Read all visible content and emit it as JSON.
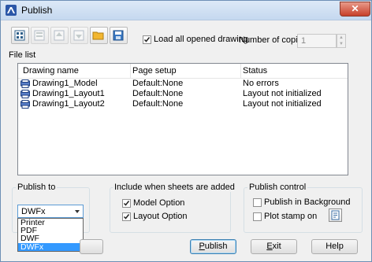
{
  "window": {
    "title": "Publish",
    "close_label": "✕"
  },
  "toolbar": {
    "buttons": [
      {
        "name": "add-sheets-icon",
        "enabled": true
      },
      {
        "name": "remove-sheets-icon",
        "enabled": false
      },
      {
        "name": "move-up-icon",
        "enabled": false
      },
      {
        "name": "move-down-icon",
        "enabled": false
      },
      {
        "name": "open-folder-icon",
        "enabled": true
      },
      {
        "name": "save-list-icon",
        "enabled": true
      }
    ]
  },
  "load_all": {
    "label": "Load all opened drawing",
    "checked": true
  },
  "copies": {
    "label": "Number of copies:",
    "value": "1"
  },
  "file_list": {
    "title": "File list",
    "headers": [
      "Drawing name",
      "Page setup",
      "Status"
    ],
    "rows": [
      {
        "name": "Drawing1_Model",
        "page_setup": "Default:None",
        "status": "No errors"
      },
      {
        "name": "Drawing1_Layout1",
        "page_setup": "Default:None",
        "status": "Layout not initialized"
      },
      {
        "name": "Drawing1_Layout2",
        "page_setup": "Default:None",
        "status": "Layout not initialized"
      }
    ]
  },
  "publish_to": {
    "title": "Publish to",
    "selected": "DWFx",
    "options": [
      "Printer",
      "PDF",
      "DWF",
      "DWFx"
    ]
  },
  "include": {
    "title": "Include when sheets are added",
    "model_option": {
      "label": "Model Option",
      "checked": true
    },
    "layout_option": {
      "label": "Layout Option",
      "checked": true
    }
  },
  "publish_control": {
    "title": "Publish control",
    "background": {
      "label": "Publish in Background",
      "checked": false
    },
    "plot_stamp": {
      "label": "Plot stamp on",
      "checked": false
    }
  },
  "buttons": {
    "publish": {
      "label": "Publish",
      "mnemonic": "P",
      "rest": "ublish"
    },
    "exit": {
      "label": "Exit",
      "mnemonic": "E",
      "rest": "xit"
    },
    "help": {
      "label": "Help"
    }
  }
}
